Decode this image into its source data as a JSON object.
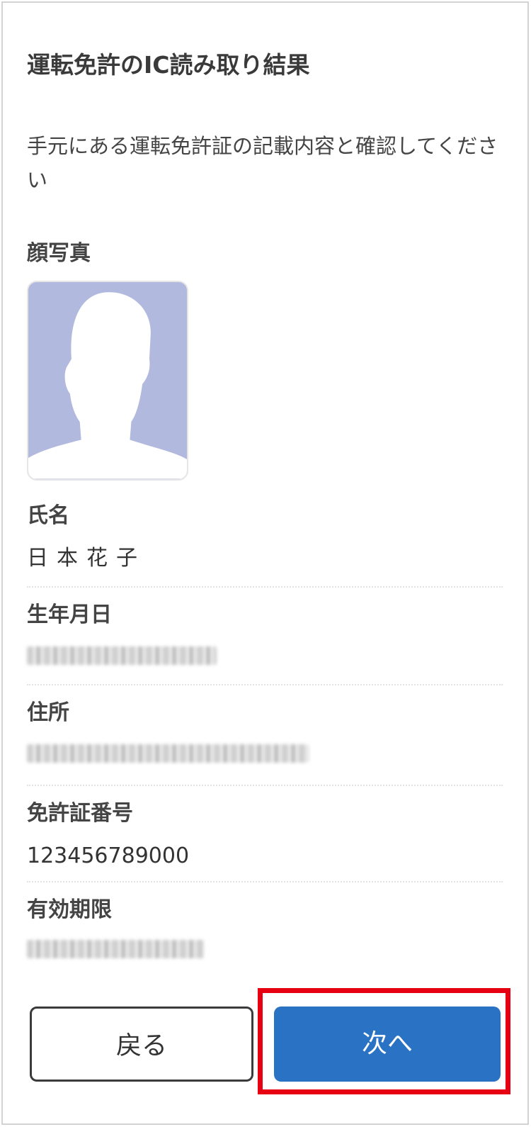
{
  "header": {
    "title": "運転免許のIC読み取り結果"
  },
  "instruction": "手元にある運転免許証の記載内容と確認してください",
  "photo": {
    "label": "顔写真",
    "placeholder_icon": "person-silhouette-icon",
    "background_color": "#b2b9de"
  },
  "fields": {
    "name": {
      "label": "氏名",
      "value": "日本花子"
    },
    "birthdate": {
      "label": "生年月日",
      "value_state": "blurred"
    },
    "address": {
      "label": "住所",
      "value_state": "blurred"
    },
    "license_number": {
      "label": "免許証番号",
      "value": "123456789000"
    },
    "expiry": {
      "label": "有効期限",
      "value_state": "blurred"
    }
  },
  "actions": {
    "back_label": "戻る",
    "next_label": "次へ"
  },
  "colors": {
    "primary": "#2a72c3",
    "highlight": "#e60012",
    "text": "#333333"
  }
}
